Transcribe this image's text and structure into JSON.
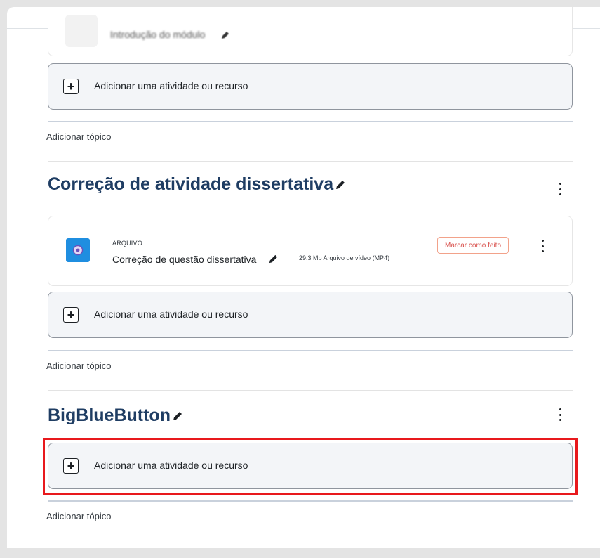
{
  "top_module": {
    "activity_name": "Introdução do módulo"
  },
  "add_activity_label": "Adicionar uma atividade ou recurso",
  "add_topic_label": "Adicionar tópico",
  "sections": [
    {
      "title": "Correção de atividade dissertativa",
      "activities": [
        {
          "type_label": "ARQUIVO",
          "name": "Correção de questão dissertativa",
          "meta": "29.3 Mb Arquivo de vídeo (MP4)",
          "completion_button": "Marcar como feito",
          "icon": "video-file-icon"
        }
      ]
    },
    {
      "title": "BigBlueButton",
      "activities": []
    }
  ],
  "colors": {
    "section_title": "#1f3d63",
    "highlight": "#e8191d",
    "completion_button": "#d9534f",
    "file_icon_bg": "#1f8ee0"
  }
}
